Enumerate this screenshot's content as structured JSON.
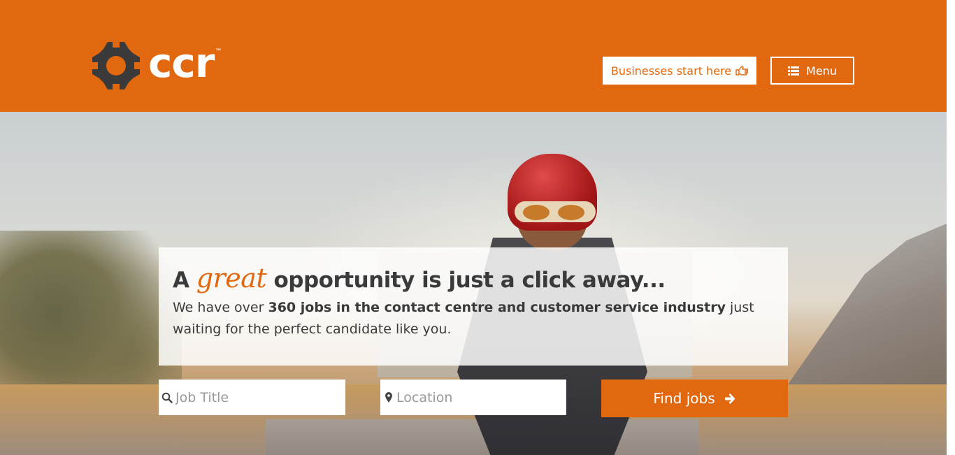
{
  "brand": {
    "name": "ccr",
    "tm": "™",
    "accent_color": "#e2680f"
  },
  "header": {
    "business_button": {
      "label": "Businesses start here",
      "icon": "hand-pointing-right-icon"
    },
    "menu_button": {
      "label": "Menu",
      "icon": "list-icon"
    }
  },
  "hero": {
    "headline_prefix": "A",
    "headline_accent": "great",
    "headline_suffix": "opportunity is just a click away...",
    "subtext_before": "We have over ",
    "subtext_bold": "360 jobs in the contact centre and customer service industry",
    "subtext_after": " just waiting for the perfect candidate like you."
  },
  "search": {
    "job_title": {
      "placeholder": "Job Title",
      "value": "",
      "icon": "search-icon"
    },
    "location": {
      "placeholder": "Location",
      "value": "",
      "icon": "map-marker-icon"
    },
    "submit": {
      "label": "Find jobs",
      "icon": "arrow-right-icon"
    }
  }
}
